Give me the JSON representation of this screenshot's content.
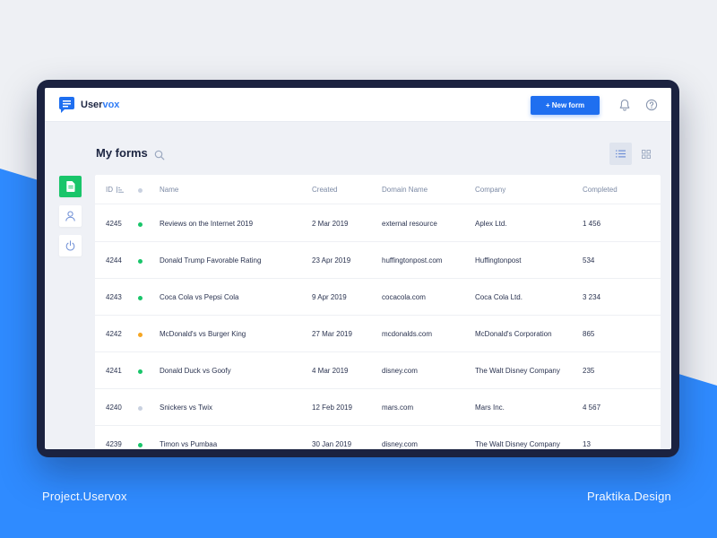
{
  "app": {
    "logo_main": "User",
    "logo_accent": "vox"
  },
  "header": {
    "new_form_label": "+ New form"
  },
  "page": {
    "title": "My forms"
  },
  "columns": {
    "id": "ID",
    "name": "Name",
    "created": "Created",
    "domain": "Domain Name",
    "company": "Company",
    "completed": "Completed"
  },
  "rows": [
    {
      "id": "4245",
      "status": "active",
      "status_color": "#19c56a",
      "name": "Reviews on the Internet 2019",
      "created": "2 Mar 2019",
      "domain": "external resource",
      "company": "Aplex Ltd.",
      "completed": "1 456"
    },
    {
      "id": "4244",
      "status": "active",
      "status_color": "#19c56a",
      "name": "Donald Trump Favorable Rating",
      "created": "23 Apr 2019",
      "domain": "huffingtonpost.com",
      "company": "Huffingtonpost",
      "completed": "534"
    },
    {
      "id": "4243",
      "status": "active",
      "status_color": "#19c56a",
      "name": "Coca Cola vs Pepsi Cola",
      "created": "9 Apr 2019",
      "domain": "cocacola.com",
      "company": "Coca Cola Ltd.",
      "completed": "3 234"
    },
    {
      "id": "4242",
      "status": "pending",
      "status_color": "#f5a623",
      "name": "McDonald's vs Burger King",
      "created": "27 Mar 2019",
      "domain": "mcdonalds.com",
      "company": "McDonald's Corporation",
      "completed": "865"
    },
    {
      "id": "4241",
      "status": "active",
      "status_color": "#19c56a",
      "name": "Donald Duck vs Goofy",
      "created": "4 Mar 2019",
      "domain": "disney.com",
      "company": "The Walt Disney Company",
      "completed": "235"
    },
    {
      "id": "4240",
      "status": "inactive",
      "status_color": "#c9d1e0",
      "name": "Snickers vs Twix",
      "created": "12 Feb 2019",
      "domain": "mars.com",
      "company": "Mars Inc.",
      "completed": "4 567"
    },
    {
      "id": "4239",
      "status": "active",
      "status_color": "#19c56a",
      "name": "Timon vs Pumbaa",
      "created": "30 Jan 2019",
      "domain": "disney.com",
      "company": "The Walt Disney Company",
      "completed": "13"
    }
  ],
  "footer": {
    "left": "Project.Uservox",
    "right": "Praktika.Design"
  },
  "colors": {
    "accent": "#1f6ff0",
    "success": "#19c56a",
    "warning": "#f5a623",
    "device": "#1b2240",
    "background_blue": "#2f8bff"
  }
}
